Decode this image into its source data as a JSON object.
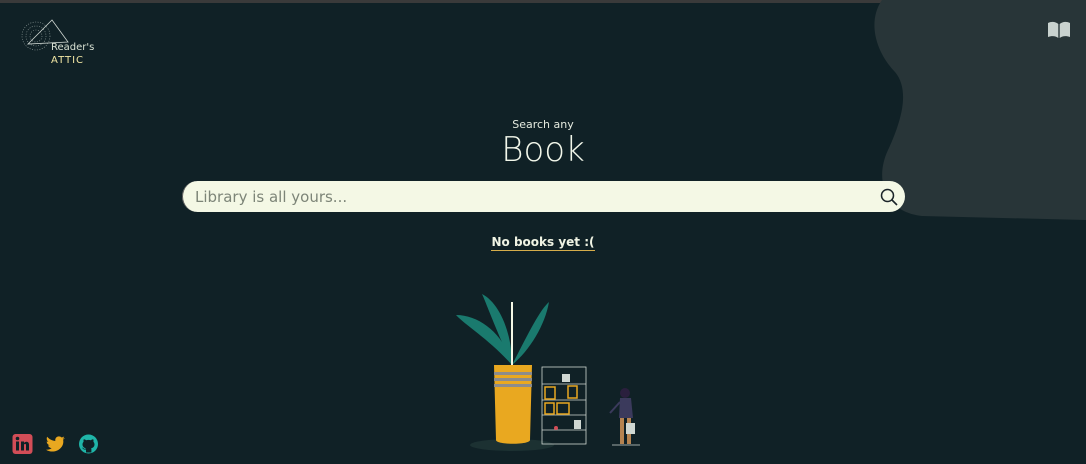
{
  "logo": {
    "line1": "Reader's",
    "line2": "ATTIC",
    "icon": "logo-triangle-globe"
  },
  "header": {
    "icon": "book-icon"
  },
  "hero": {
    "subtitle": "Search any",
    "title": "Book"
  },
  "search": {
    "placeholder": "Library is all yours...",
    "value": "",
    "icon": "search-icon"
  },
  "results": {
    "empty_message": "No books yet :("
  },
  "social": [
    {
      "name": "linkedin",
      "icon": "linkedin-icon",
      "color": "#d24d57"
    },
    {
      "name": "twitter",
      "icon": "twitter-icon",
      "color": "#e9a820"
    },
    {
      "name": "github",
      "icon": "github-icon",
      "color": "#1fb5a8"
    }
  ],
  "colors": {
    "background": "#102126",
    "blob": "#283538",
    "search_bg": "#f4f8e5",
    "accent": "#e9a820"
  }
}
